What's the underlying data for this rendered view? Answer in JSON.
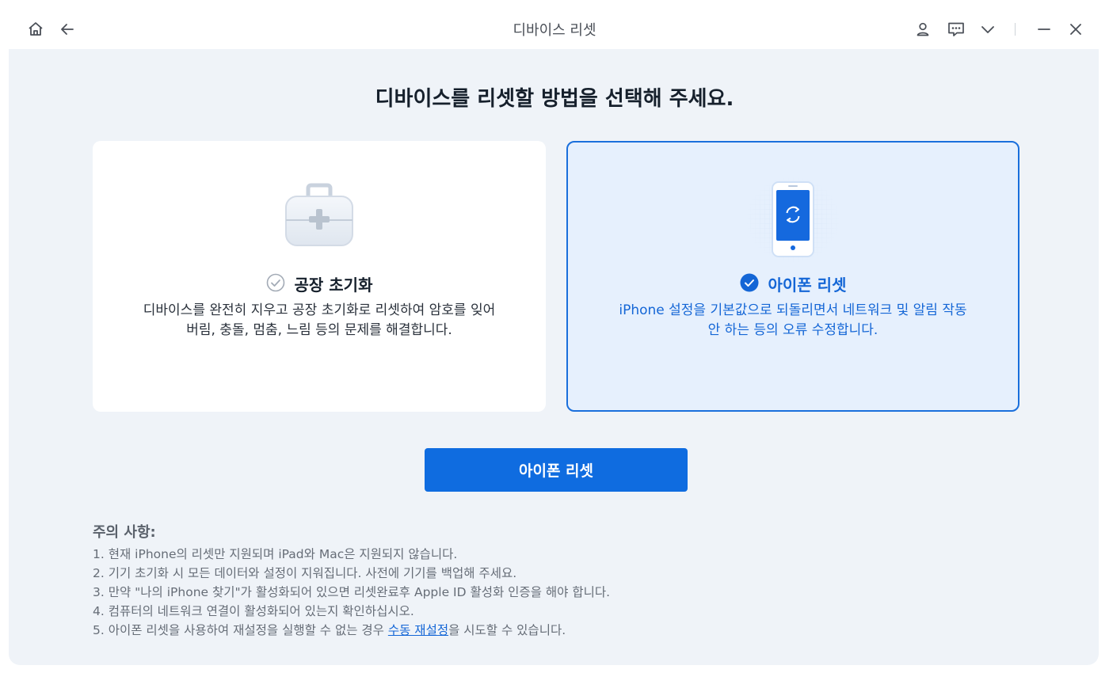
{
  "window": {
    "title": "디바이스 리셋",
    "icons": [
      "home-icon",
      "back-arrow-icon",
      "user-icon",
      "feedback-icon",
      "chevron-down-icon",
      "minimize-icon",
      "close-icon"
    ]
  },
  "main": {
    "heading": "디바이스를 리셋할 방법을 선택해 주세요.",
    "options": [
      {
        "title": "공장 초기화",
        "description_line1": "디바이스를 완전히 지우고 공장 초기화로 리셋하여 암호를 잊어",
        "description_line2": "버림, 충돌, 멈춤, 느림 등의 문제를 해결합니다.",
        "selected": false,
        "icon": "toolbox-icon"
      },
      {
        "title": "아이폰 리셋",
        "description_line1": "iPhone 설정을 기본값으로 되돌리면서 네트워크 및 알림 작동",
        "description_line2": "안 하는 등의 오류 수정합니다.",
        "selected": true,
        "icon": "phone-reset-icon"
      }
    ],
    "action_button": "아이폰 리셋"
  },
  "notes": {
    "title": "주의 사항:",
    "items": [
      "1. 현재 iPhone의 리셋만 지원되며 iPad와 Mac은 지원되지 않습니다.",
      "2. 기기 초기화 시 모든 데이터와 설정이 지워집니다. 사전에 기기를 백업해 주세요.",
      "3. 만약 \"나의 iPhone 찾기\"가 활성화되어 있으면 리셋완료후 Apple ID 활성화 인증을 해야 합니다.",
      "4. 컴퓨터의 네트워크 연결이 활성화되어 있는지 확인하십시오."
    ],
    "item5_prefix": "5. 아이폰 리셋을 사용하여 재설정을 실행할 수 없는 경우 ",
    "item5_link": "수동 재설정",
    "item5_suffix": "을 시도할 수 있습니다."
  },
  "colors": {
    "accent": "#0f6ce0",
    "selected_border": "#1a6fdc",
    "selected_bg": "#e6f0fd",
    "panel_bg": "#eff3f8"
  }
}
